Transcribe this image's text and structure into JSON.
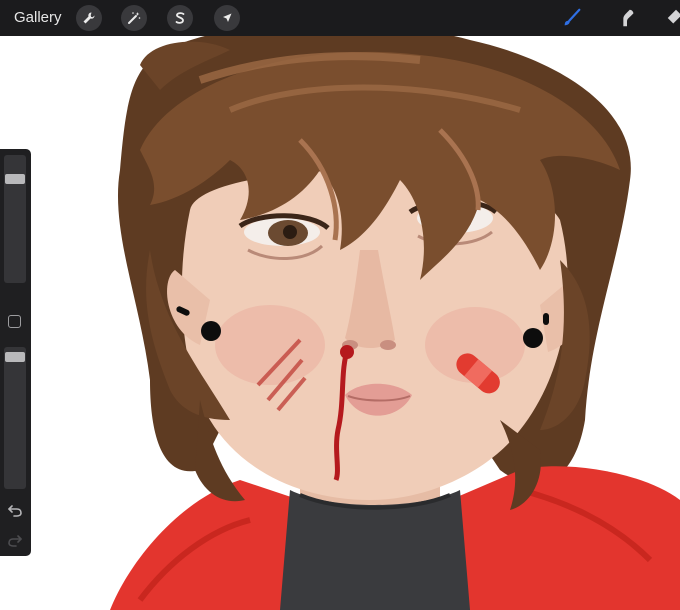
{
  "toolbar": {
    "gallery_label": "Gallery",
    "left_tools": [
      {
        "name": "actions",
        "icon": "wrench-icon"
      },
      {
        "name": "adjustments",
        "icon": "magic-wand-icon"
      },
      {
        "name": "selection",
        "icon": "selection-s-icon"
      },
      {
        "name": "transform",
        "icon": "arrow-cursor-icon"
      }
    ],
    "right_tools": [
      {
        "name": "brush",
        "icon": "brush-icon",
        "active": true
      },
      {
        "name": "smudge",
        "icon": "smudge-icon",
        "active": false
      },
      {
        "name": "eraser",
        "icon": "eraser-icon",
        "active": false
      }
    ]
  },
  "sidebar": {
    "brush_size_level": 0.84,
    "opacity_level": 0.96,
    "icons": [
      "modify-square-icon",
      "undo-icon",
      "redo-icon"
    ]
  },
  "colors": {
    "toolbar_bg": "#1b1b1d",
    "active_tool": "#2f6fe4",
    "hair": "#6b4428",
    "skin": "#f0cdb8",
    "hoodie": "#e3352e",
    "shirt": "#3a3b3e",
    "blood": "#b5191d"
  }
}
